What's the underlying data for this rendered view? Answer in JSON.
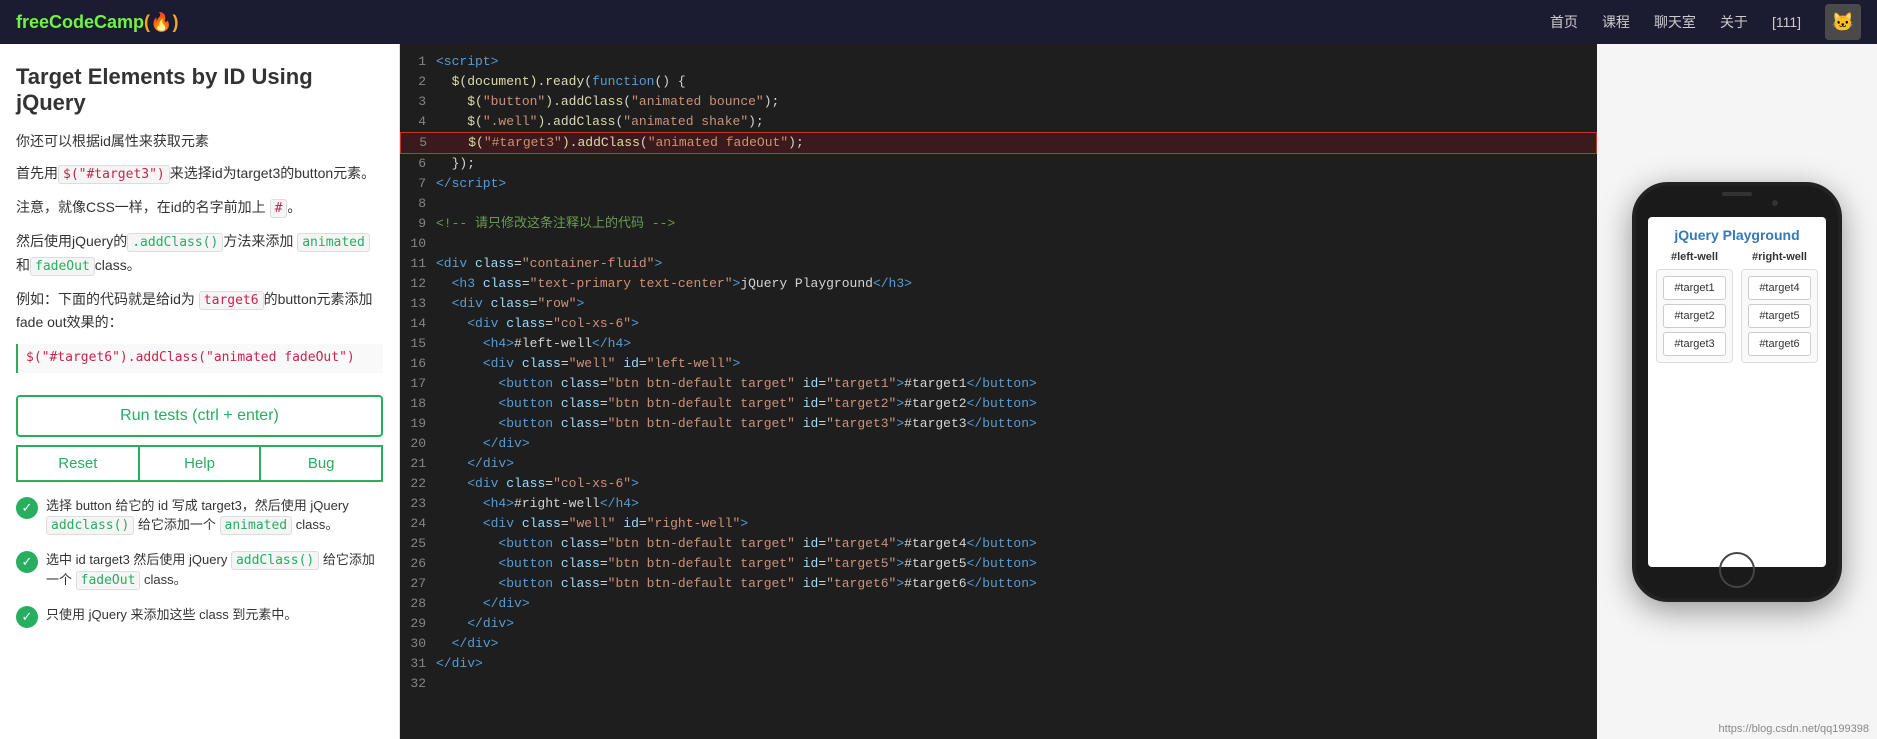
{
  "header": {
    "logo_free": "freeCodeCamp",
    "logo_flame": "🔥",
    "nav": [
      "首页",
      "课程",
      "聊天室",
      "关于",
      "[111]"
    ]
  },
  "left_panel": {
    "title": "Target Elements by ID Using jQuery",
    "desc_lines": [
      "你还可以根据id属性来获取元素",
      "首先用$(\"#target3\")来选择id为target3的button元素。",
      "注意，就像CSS一样，在id的名字前加上 #。",
      "然后使用jQuery的.addClass()方法来添加 animated和fadeOut class。",
      "例如：下面的代码就是给id为target6的button元素添加fade out效果的："
    ],
    "code_example": "$(\"#target6\").addClass(\"animated fadeOut\")",
    "run_tests": "Run tests (ctrl + enter)",
    "reset": "Reset",
    "help": "Help",
    "bug": "Bug",
    "test_results": [
      {
        "text": "选择 button 给它的 id 写成 target3，然后使用 jQuery addclass() 给它添加一个 animated class。"
      },
      {
        "text": "选中 id target3 然后使用 jQuery addClass() 给它添加一个 fadeOut class。"
      },
      {
        "text": "只使用 jQuery 来添加这些 class 到元素中。"
      }
    ]
  },
  "code_editor": {
    "lines": [
      {
        "num": 1,
        "content": "<script>"
      },
      {
        "num": 2,
        "content": "  $(document).ready(function() {"
      },
      {
        "num": 3,
        "content": "    $(\"button\").addClass(\"animated bounce\");"
      },
      {
        "num": 4,
        "content": "    $(\".well\").addClass(\"animated shake\");"
      },
      {
        "num": 5,
        "content": "    $(\"#target3\").addClass(\"animated fadeOut\");",
        "highlight": true
      },
      {
        "num": 6,
        "content": "  });"
      },
      {
        "num": 7,
        "content": "<\\/script>"
      },
      {
        "num": 8,
        "content": ""
      },
      {
        "num": 9,
        "content": "<!-- 请只修改这条注释以上的代码 -->"
      },
      {
        "num": 10,
        "content": ""
      },
      {
        "num": 11,
        "content": "<div class=\"container-fluid\">"
      },
      {
        "num": 12,
        "content": "  <h3 class=\"text-primary text-center\">jQuery Playground<\\/h3>"
      },
      {
        "num": 13,
        "content": "  <div class=\"row\">"
      },
      {
        "num": 14,
        "content": "    <div class=\"col-xs-6\">"
      },
      {
        "num": 15,
        "content": "      <h4>#left-well<\\/h4>"
      },
      {
        "num": 16,
        "content": "      <div class=\"well\" id=\"left-well\">"
      },
      {
        "num": 17,
        "content": "        <button class=\"btn btn-default target\" id=\"target1\">#target1<\\/button>"
      },
      {
        "num": 18,
        "content": "        <button class=\"btn btn-default target\" id=\"target2\">#target2<\\/button>"
      },
      {
        "num": 19,
        "content": "        <button class=\"btn btn-default target\" id=\"target3\">#target3<\\/button>"
      },
      {
        "num": 20,
        "content": "      <\\/div>"
      },
      {
        "num": 21,
        "content": "    <\\/div>"
      },
      {
        "num": 22,
        "content": "    <div class=\"col-xs-6\">"
      },
      {
        "num": 23,
        "content": "      <h4>#right-well<\\/h4>"
      },
      {
        "num": 24,
        "content": "      <div class=\"well\" id=\"right-well\">"
      },
      {
        "num": 25,
        "content": "        <button class=\"btn btn-default target\" id=\"target4\">#target4<\\/button>"
      },
      {
        "num": 26,
        "content": "        <button class=\"btn btn-default target\" id=\"target5\">#target5<\\/button>"
      },
      {
        "num": 27,
        "content": "        <button class=\"btn btn-default target\" id=\"target6\">#target6<\\/button>"
      },
      {
        "num": 28,
        "content": "      <\\/div>"
      },
      {
        "num": 29,
        "content": "    <\\/div>"
      },
      {
        "num": 30,
        "content": "  <\\/div>"
      },
      {
        "num": 31,
        "content": "<\\/div>"
      },
      {
        "num": 32,
        "content": ""
      }
    ]
  },
  "preview": {
    "title": "jQuery Playground",
    "left_well": "#left-well",
    "right_well": "#right-well",
    "left_buttons": [
      "#target1",
      "#target2",
      "#target3"
    ],
    "right_buttons": [
      "#target4",
      "#target5",
      "#target6"
    ]
  },
  "watermark": "https://blog.csdn.net/qq199398"
}
